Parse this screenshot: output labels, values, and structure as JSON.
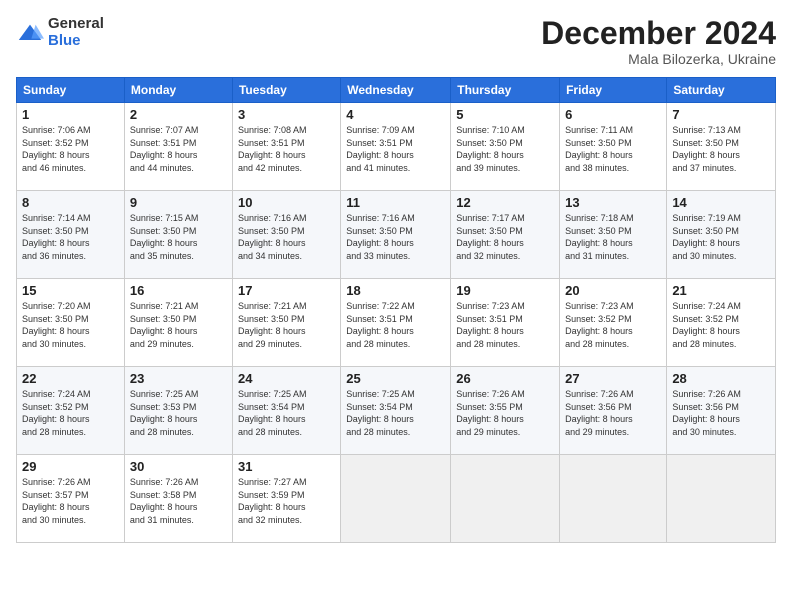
{
  "logo": {
    "general": "General",
    "blue": "Blue"
  },
  "header": {
    "month": "December 2024",
    "location": "Mala Bilozerka, Ukraine"
  },
  "weekdays": [
    "Sunday",
    "Monday",
    "Tuesday",
    "Wednesday",
    "Thursday",
    "Friday",
    "Saturday"
  ],
  "weeks": [
    [
      {
        "day": "1",
        "info": "Sunrise: 7:06 AM\nSunset: 3:52 PM\nDaylight: 8 hours\nand 46 minutes."
      },
      {
        "day": "2",
        "info": "Sunrise: 7:07 AM\nSunset: 3:51 PM\nDaylight: 8 hours\nand 44 minutes."
      },
      {
        "day": "3",
        "info": "Sunrise: 7:08 AM\nSunset: 3:51 PM\nDaylight: 8 hours\nand 42 minutes."
      },
      {
        "day": "4",
        "info": "Sunrise: 7:09 AM\nSunset: 3:51 PM\nDaylight: 8 hours\nand 41 minutes."
      },
      {
        "day": "5",
        "info": "Sunrise: 7:10 AM\nSunset: 3:50 PM\nDaylight: 8 hours\nand 39 minutes."
      },
      {
        "day": "6",
        "info": "Sunrise: 7:11 AM\nSunset: 3:50 PM\nDaylight: 8 hours\nand 38 minutes."
      },
      {
        "day": "7",
        "info": "Sunrise: 7:13 AM\nSunset: 3:50 PM\nDaylight: 8 hours\nand 37 minutes."
      }
    ],
    [
      {
        "day": "8",
        "info": "Sunrise: 7:14 AM\nSunset: 3:50 PM\nDaylight: 8 hours\nand 36 minutes."
      },
      {
        "day": "9",
        "info": "Sunrise: 7:15 AM\nSunset: 3:50 PM\nDaylight: 8 hours\nand 35 minutes."
      },
      {
        "day": "10",
        "info": "Sunrise: 7:16 AM\nSunset: 3:50 PM\nDaylight: 8 hours\nand 34 minutes."
      },
      {
        "day": "11",
        "info": "Sunrise: 7:16 AM\nSunset: 3:50 PM\nDaylight: 8 hours\nand 33 minutes."
      },
      {
        "day": "12",
        "info": "Sunrise: 7:17 AM\nSunset: 3:50 PM\nDaylight: 8 hours\nand 32 minutes."
      },
      {
        "day": "13",
        "info": "Sunrise: 7:18 AM\nSunset: 3:50 PM\nDaylight: 8 hours\nand 31 minutes."
      },
      {
        "day": "14",
        "info": "Sunrise: 7:19 AM\nSunset: 3:50 PM\nDaylight: 8 hours\nand 30 minutes."
      }
    ],
    [
      {
        "day": "15",
        "info": "Sunrise: 7:20 AM\nSunset: 3:50 PM\nDaylight: 8 hours\nand 30 minutes."
      },
      {
        "day": "16",
        "info": "Sunrise: 7:21 AM\nSunset: 3:50 PM\nDaylight: 8 hours\nand 29 minutes."
      },
      {
        "day": "17",
        "info": "Sunrise: 7:21 AM\nSunset: 3:50 PM\nDaylight: 8 hours\nand 29 minutes."
      },
      {
        "day": "18",
        "info": "Sunrise: 7:22 AM\nSunset: 3:51 PM\nDaylight: 8 hours\nand 28 minutes."
      },
      {
        "day": "19",
        "info": "Sunrise: 7:23 AM\nSunset: 3:51 PM\nDaylight: 8 hours\nand 28 minutes."
      },
      {
        "day": "20",
        "info": "Sunrise: 7:23 AM\nSunset: 3:52 PM\nDaylight: 8 hours\nand 28 minutes."
      },
      {
        "day": "21",
        "info": "Sunrise: 7:24 AM\nSunset: 3:52 PM\nDaylight: 8 hours\nand 28 minutes."
      }
    ],
    [
      {
        "day": "22",
        "info": "Sunrise: 7:24 AM\nSunset: 3:52 PM\nDaylight: 8 hours\nand 28 minutes."
      },
      {
        "day": "23",
        "info": "Sunrise: 7:25 AM\nSunset: 3:53 PM\nDaylight: 8 hours\nand 28 minutes."
      },
      {
        "day": "24",
        "info": "Sunrise: 7:25 AM\nSunset: 3:54 PM\nDaylight: 8 hours\nand 28 minutes."
      },
      {
        "day": "25",
        "info": "Sunrise: 7:25 AM\nSunset: 3:54 PM\nDaylight: 8 hours\nand 28 minutes."
      },
      {
        "day": "26",
        "info": "Sunrise: 7:26 AM\nSunset: 3:55 PM\nDaylight: 8 hours\nand 29 minutes."
      },
      {
        "day": "27",
        "info": "Sunrise: 7:26 AM\nSunset: 3:56 PM\nDaylight: 8 hours\nand 29 minutes."
      },
      {
        "day": "28",
        "info": "Sunrise: 7:26 AM\nSunset: 3:56 PM\nDaylight: 8 hours\nand 30 minutes."
      }
    ],
    [
      {
        "day": "29",
        "info": "Sunrise: 7:26 AM\nSunset: 3:57 PM\nDaylight: 8 hours\nand 30 minutes."
      },
      {
        "day": "30",
        "info": "Sunrise: 7:26 AM\nSunset: 3:58 PM\nDaylight: 8 hours\nand 31 minutes."
      },
      {
        "day": "31",
        "info": "Sunrise: 7:27 AM\nSunset: 3:59 PM\nDaylight: 8 hours\nand 32 minutes."
      },
      {
        "day": "",
        "info": ""
      },
      {
        "day": "",
        "info": ""
      },
      {
        "day": "",
        "info": ""
      },
      {
        "day": "",
        "info": ""
      }
    ]
  ]
}
